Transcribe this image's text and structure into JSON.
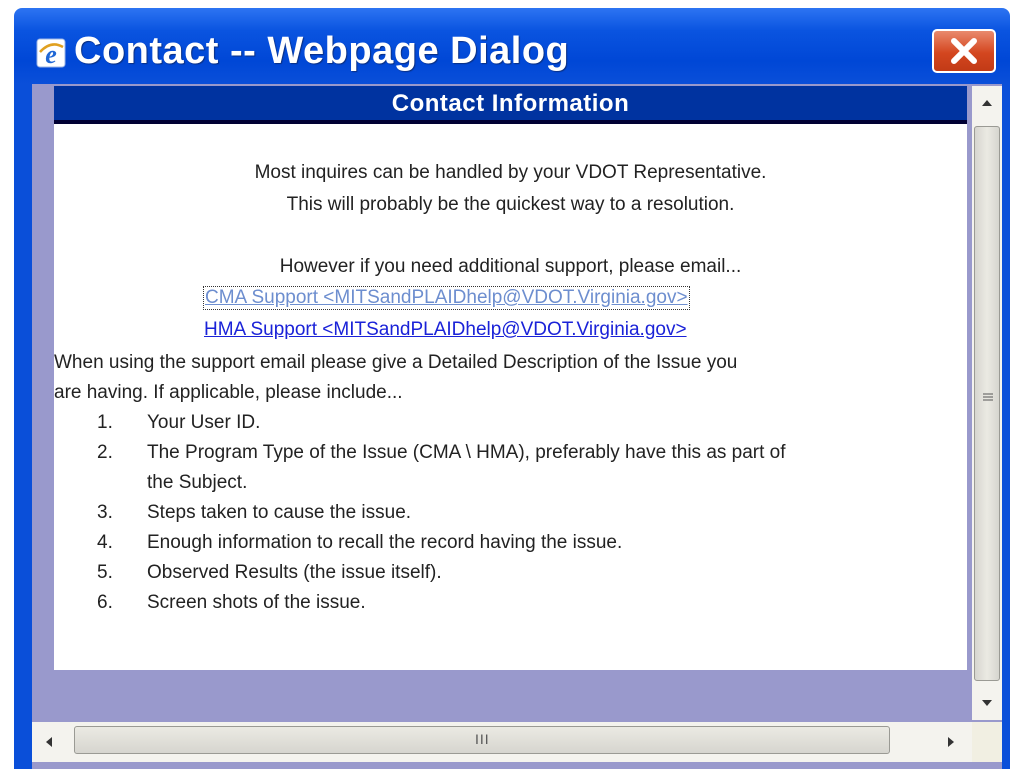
{
  "window": {
    "title": "Contact -- Webpage Dialog"
  },
  "page": {
    "header": "Contact Information",
    "intro_lines": [
      "Most inquires can be handled by your VDOT Representative.",
      "This will probably be the quickest way to a resolution.",
      "However if you need additional support, please email..."
    ],
    "links": {
      "cma": "CMA Support <MITSandPLAIDhelp@VDOT.Virginia.gov>",
      "hma": "HMA Support <MITSandPLAIDhelp@VDOT.Virginia.gov>"
    },
    "description": [
      "When using the support email please give a Detailed Description of the Issue you",
      "are having. If applicable, please include..."
    ],
    "list": [
      {
        "num": "1.",
        "text": "Your User ID."
      },
      {
        "num": "2.",
        "text": "The Program Type of the Issue (CMA \\ HMA), preferably have this as part of"
      },
      {
        "num": "",
        "text": "the Subject."
      },
      {
        "num": "3.",
        "text": "Steps taken to cause the issue."
      },
      {
        "num": "4.",
        "text": "Enough information to recall the record having the issue."
      },
      {
        "num": "5.",
        "text": "Observed Results (the issue itself)."
      },
      {
        "num": "6.",
        "text": "Screen shots of the issue."
      }
    ]
  },
  "scrollbar": {
    "h_grip": "III"
  },
  "colors": {
    "titlebar": "#0a4fd9",
    "header_bg": "#0033a0",
    "client_bg": "#9999cc",
    "link_visited": "#6d8ecf",
    "link": "#1a22d8",
    "close_button": "#d4461f"
  },
  "icons": [
    "ie-icon",
    "close-icon",
    "scroll-up-arrow-icon",
    "scroll-down-arrow-icon",
    "scroll-left-arrow-icon",
    "scroll-right-arrow-icon"
  ]
}
